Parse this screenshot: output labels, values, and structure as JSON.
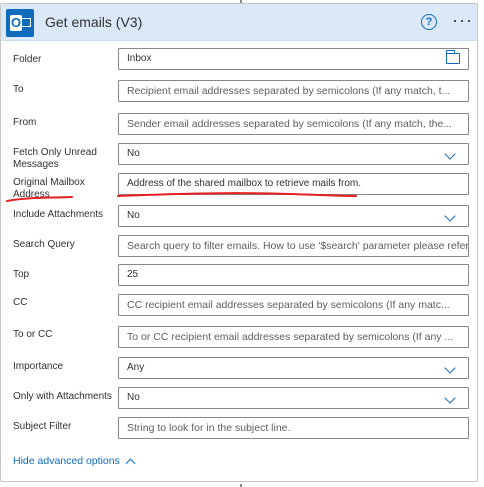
{
  "card": {
    "title": "Get emails (V3)",
    "help_icon": "help-circle-icon",
    "more_icon": "more-options-icon",
    "connector_icon": "outlook-icon"
  },
  "fields": {
    "folder": {
      "label": "Folder",
      "value": "Inbox",
      "icon": "folder-icon"
    },
    "to": {
      "label": "To",
      "placeholder": "Recipient email addresses separated by semicolons (If any match, t..."
    },
    "from": {
      "label": "From",
      "placeholder": "Sender email addresses separated by semicolons (If any match, the..."
    },
    "fetch_unread": {
      "label": "Fetch Only Unread Messages",
      "value": "No"
    },
    "original_mailbox": {
      "label": "Original Mailbox Address",
      "value": "Address of the shared mailbox to retrieve mails from."
    },
    "include_attachments": {
      "label": "Include Attachments",
      "value": "No"
    },
    "search_query": {
      "label": "Search Query",
      "placeholder": "Search query to filter emails. How to use '$search' parameter please refer to: ht"
    },
    "top": {
      "label": "Top",
      "value": "25"
    },
    "cc": {
      "label": "CC",
      "placeholder": "CC recipient email addresses separated by semicolons (If any matc..."
    },
    "to_or_cc": {
      "label": "To or CC",
      "placeholder": "To or CC recipient email addresses separated by semicolons (If any ..."
    },
    "importance": {
      "label": "Importance",
      "value": "Any"
    },
    "only_with_attachments": {
      "label": "Only with Attachments",
      "value": "No"
    },
    "subject_filter": {
      "label": "Subject Filter",
      "placeholder": "String to look for in the subject line."
    }
  },
  "footer": {
    "hide_advanced": "Hide advanced options"
  },
  "colors": {
    "accent": "#0f6cbd",
    "header_bg": "#dae8f7",
    "annotation": "#e41f1f"
  }
}
